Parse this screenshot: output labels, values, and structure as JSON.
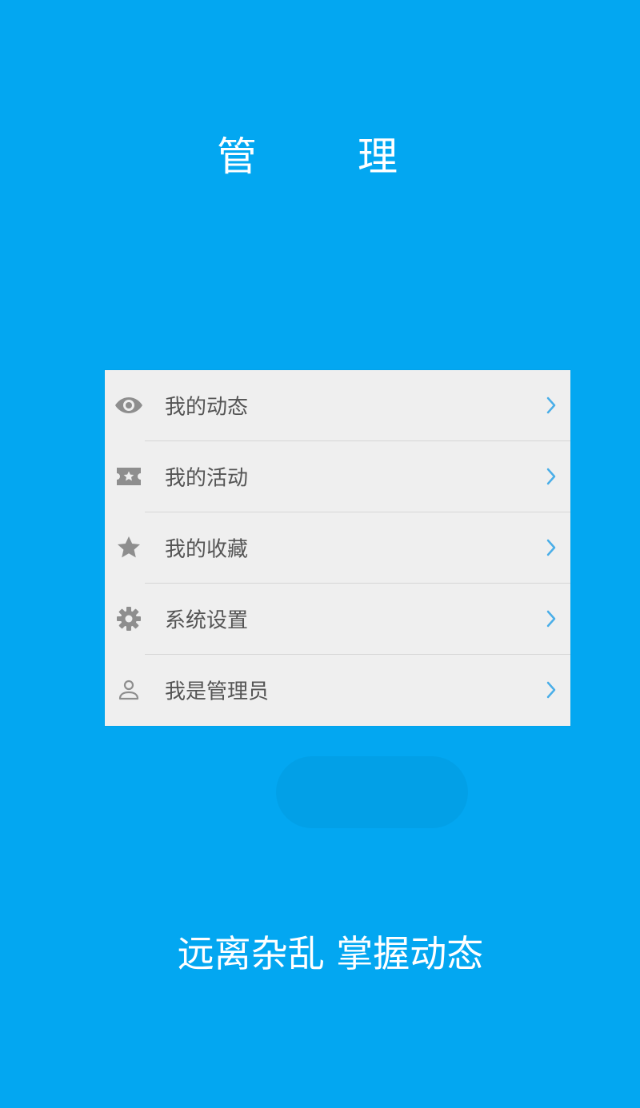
{
  "colors": {
    "background": "#03a7f1",
    "card": "#efefef",
    "divider": "#d6d6d6",
    "icon": "#8e8e8e",
    "label": "#555555",
    "chevron": "#4aaee8"
  },
  "header": {
    "title": "管　理"
  },
  "menu": {
    "items": [
      {
        "label": "我的动态",
        "icon": "eye-icon"
      },
      {
        "label": "我的活动",
        "icon": "ticket-star-icon"
      },
      {
        "label": "我的收藏",
        "icon": "star-icon"
      },
      {
        "label": "系统设置",
        "icon": "gear-icon"
      },
      {
        "label": "我是管理员",
        "icon": "person-icon"
      }
    ]
  },
  "footer": {
    "slogan": "远离杂乱 掌握动态"
  }
}
